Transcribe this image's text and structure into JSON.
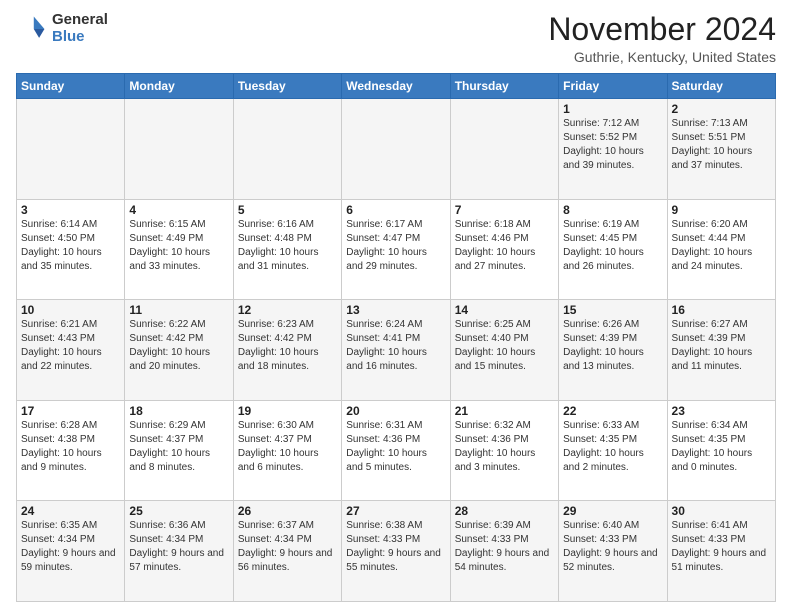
{
  "header": {
    "logo_general": "General",
    "logo_blue": "Blue",
    "title": "November 2024",
    "location": "Guthrie, Kentucky, United States"
  },
  "days_of_week": [
    "Sunday",
    "Monday",
    "Tuesday",
    "Wednesday",
    "Thursday",
    "Friday",
    "Saturday"
  ],
  "weeks": [
    [
      {
        "day": "",
        "info": ""
      },
      {
        "day": "",
        "info": ""
      },
      {
        "day": "",
        "info": ""
      },
      {
        "day": "",
        "info": ""
      },
      {
        "day": "",
        "info": ""
      },
      {
        "day": "1",
        "info": "Sunrise: 7:12 AM\nSunset: 5:52 PM\nDaylight: 10 hours and 39 minutes."
      },
      {
        "day": "2",
        "info": "Sunrise: 7:13 AM\nSunset: 5:51 PM\nDaylight: 10 hours and 37 minutes."
      }
    ],
    [
      {
        "day": "3",
        "info": "Sunrise: 6:14 AM\nSunset: 4:50 PM\nDaylight: 10 hours and 35 minutes."
      },
      {
        "day": "4",
        "info": "Sunrise: 6:15 AM\nSunset: 4:49 PM\nDaylight: 10 hours and 33 minutes."
      },
      {
        "day": "5",
        "info": "Sunrise: 6:16 AM\nSunset: 4:48 PM\nDaylight: 10 hours and 31 minutes."
      },
      {
        "day": "6",
        "info": "Sunrise: 6:17 AM\nSunset: 4:47 PM\nDaylight: 10 hours and 29 minutes."
      },
      {
        "day": "7",
        "info": "Sunrise: 6:18 AM\nSunset: 4:46 PM\nDaylight: 10 hours and 27 minutes."
      },
      {
        "day": "8",
        "info": "Sunrise: 6:19 AM\nSunset: 4:45 PM\nDaylight: 10 hours and 26 minutes."
      },
      {
        "day": "9",
        "info": "Sunrise: 6:20 AM\nSunset: 4:44 PM\nDaylight: 10 hours and 24 minutes."
      }
    ],
    [
      {
        "day": "10",
        "info": "Sunrise: 6:21 AM\nSunset: 4:43 PM\nDaylight: 10 hours and 22 minutes."
      },
      {
        "day": "11",
        "info": "Sunrise: 6:22 AM\nSunset: 4:42 PM\nDaylight: 10 hours and 20 minutes."
      },
      {
        "day": "12",
        "info": "Sunrise: 6:23 AM\nSunset: 4:42 PM\nDaylight: 10 hours and 18 minutes."
      },
      {
        "day": "13",
        "info": "Sunrise: 6:24 AM\nSunset: 4:41 PM\nDaylight: 10 hours and 16 minutes."
      },
      {
        "day": "14",
        "info": "Sunrise: 6:25 AM\nSunset: 4:40 PM\nDaylight: 10 hours and 15 minutes."
      },
      {
        "day": "15",
        "info": "Sunrise: 6:26 AM\nSunset: 4:39 PM\nDaylight: 10 hours and 13 minutes."
      },
      {
        "day": "16",
        "info": "Sunrise: 6:27 AM\nSunset: 4:39 PM\nDaylight: 10 hours and 11 minutes."
      }
    ],
    [
      {
        "day": "17",
        "info": "Sunrise: 6:28 AM\nSunset: 4:38 PM\nDaylight: 10 hours and 9 minutes."
      },
      {
        "day": "18",
        "info": "Sunrise: 6:29 AM\nSunset: 4:37 PM\nDaylight: 10 hours and 8 minutes."
      },
      {
        "day": "19",
        "info": "Sunrise: 6:30 AM\nSunset: 4:37 PM\nDaylight: 10 hours and 6 minutes."
      },
      {
        "day": "20",
        "info": "Sunrise: 6:31 AM\nSunset: 4:36 PM\nDaylight: 10 hours and 5 minutes."
      },
      {
        "day": "21",
        "info": "Sunrise: 6:32 AM\nSunset: 4:36 PM\nDaylight: 10 hours and 3 minutes."
      },
      {
        "day": "22",
        "info": "Sunrise: 6:33 AM\nSunset: 4:35 PM\nDaylight: 10 hours and 2 minutes."
      },
      {
        "day": "23",
        "info": "Sunrise: 6:34 AM\nSunset: 4:35 PM\nDaylight: 10 hours and 0 minutes."
      }
    ],
    [
      {
        "day": "24",
        "info": "Sunrise: 6:35 AM\nSunset: 4:34 PM\nDaylight: 9 hours and 59 minutes."
      },
      {
        "day": "25",
        "info": "Sunrise: 6:36 AM\nSunset: 4:34 PM\nDaylight: 9 hours and 57 minutes."
      },
      {
        "day": "26",
        "info": "Sunrise: 6:37 AM\nSunset: 4:34 PM\nDaylight: 9 hours and 56 minutes."
      },
      {
        "day": "27",
        "info": "Sunrise: 6:38 AM\nSunset: 4:33 PM\nDaylight: 9 hours and 55 minutes."
      },
      {
        "day": "28",
        "info": "Sunrise: 6:39 AM\nSunset: 4:33 PM\nDaylight: 9 hours and 54 minutes."
      },
      {
        "day": "29",
        "info": "Sunrise: 6:40 AM\nSunset: 4:33 PM\nDaylight: 9 hours and 52 minutes."
      },
      {
        "day": "30",
        "info": "Sunrise: 6:41 AM\nSunset: 4:33 PM\nDaylight: 9 hours and 51 minutes."
      }
    ]
  ]
}
